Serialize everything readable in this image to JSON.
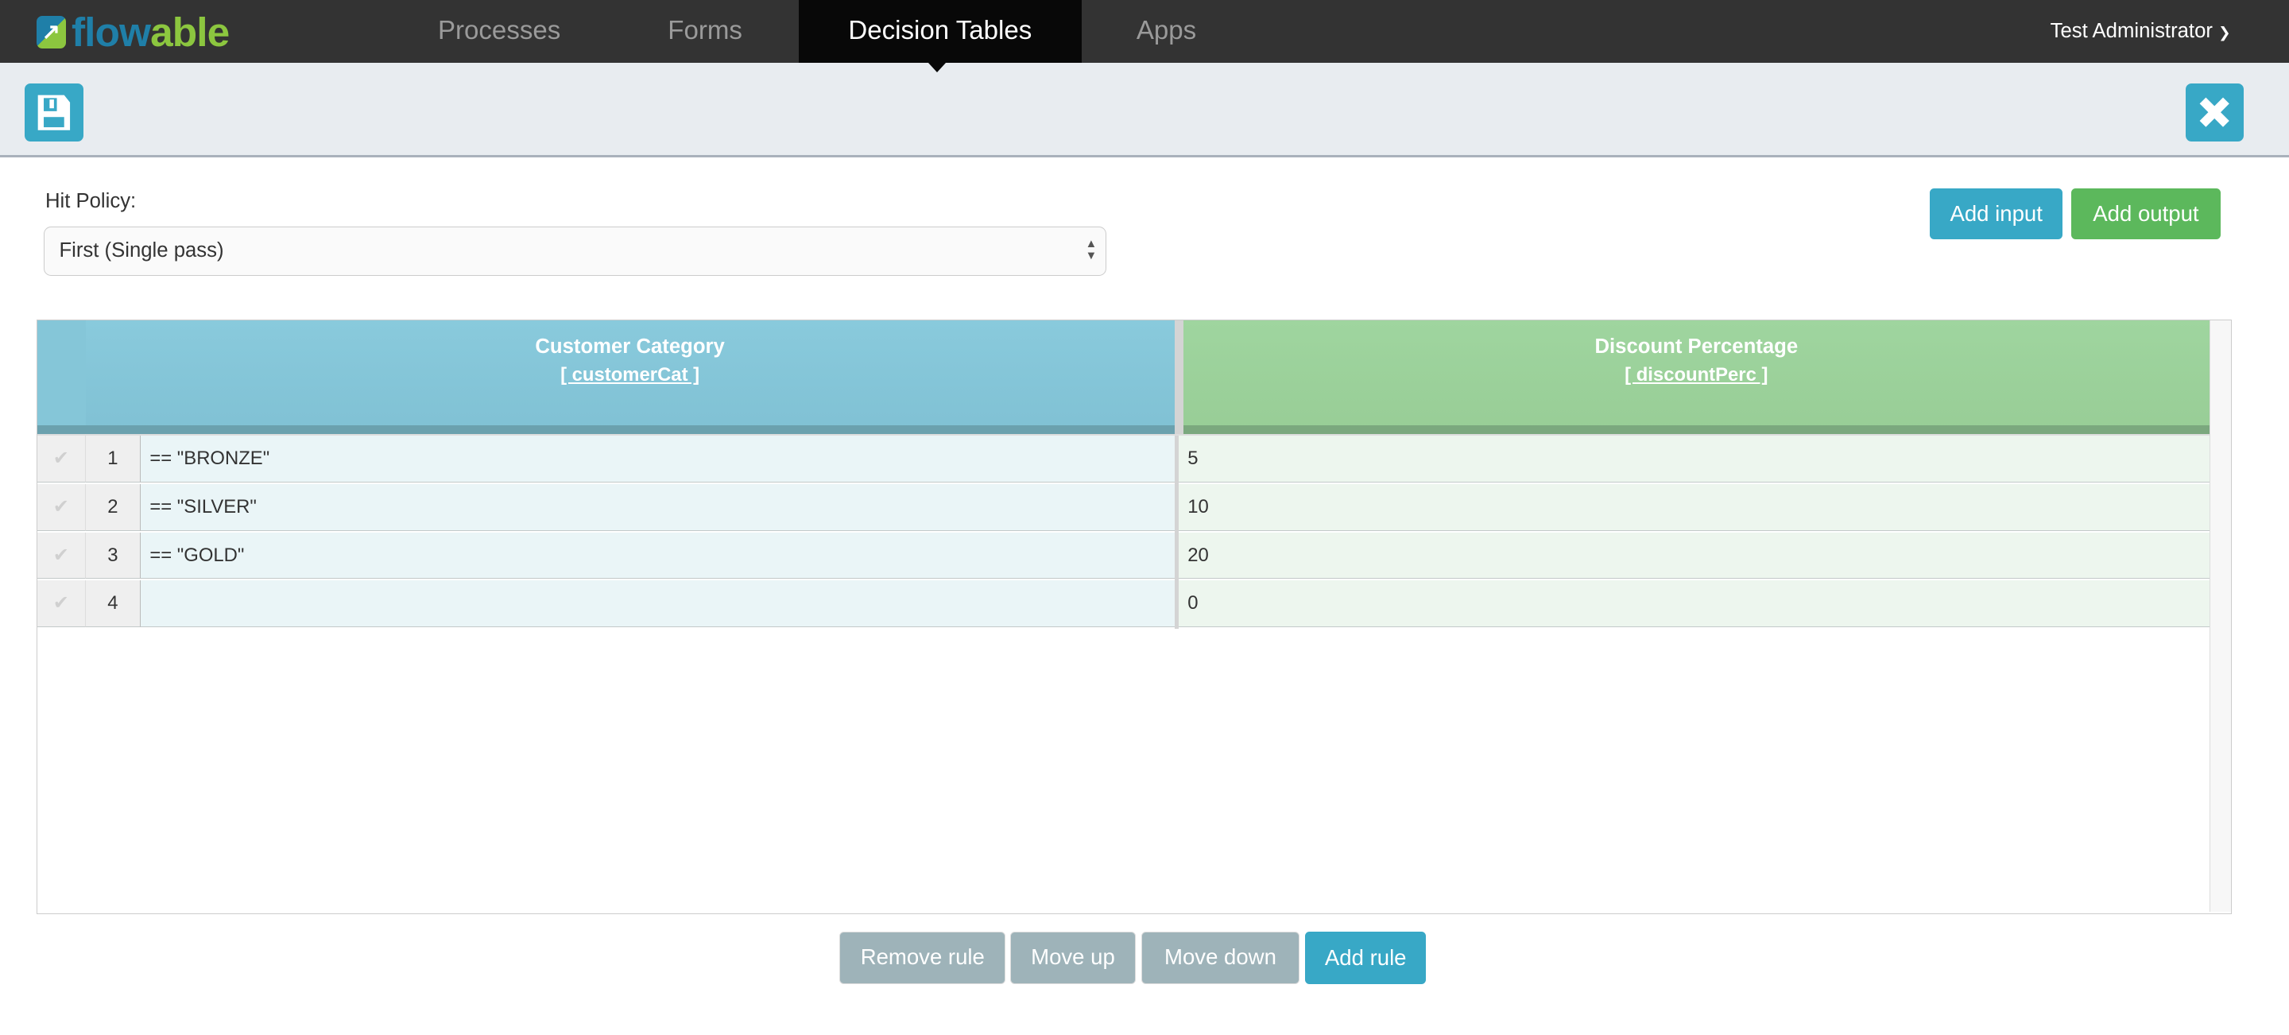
{
  "nav": {
    "logo": "flowable",
    "items": [
      {
        "label": "Processes"
      },
      {
        "label": "Forms"
      },
      {
        "label": "Decision Tables",
        "active": true
      },
      {
        "label": "Apps"
      }
    ],
    "user": "Test Administrator"
  },
  "toolbar": {
    "save_icon": "floppy-disk-icon",
    "close_icon": "close-x-icon"
  },
  "hit_policy": {
    "label": "Hit Policy:",
    "value": "First (Single pass)"
  },
  "actions": {
    "add_input": "Add input",
    "add_output": "Add output"
  },
  "table": {
    "input": {
      "title": "Customer Category",
      "variable": "[ customerCat ]"
    },
    "output": {
      "title": "Discount Percentage",
      "variable": "[ discountPerc ]"
    },
    "rows": [
      {
        "num": "1",
        "input": "== \"BRONZE\"",
        "output": "5"
      },
      {
        "num": "2",
        "input": "== \"SILVER\"",
        "output": "10"
      },
      {
        "num": "3",
        "input": "== \"GOLD\"",
        "output": "20"
      },
      {
        "num": "4",
        "input": "",
        "output": "0"
      }
    ]
  },
  "footer": {
    "remove": "Remove rule",
    "up": "Move up",
    "down": "Move down",
    "add": "Add rule"
  },
  "colors": {
    "primary": "#38a8c6",
    "success": "#5cb85c",
    "input_header": "#88c9dc",
    "output_header": "#9fd49f"
  }
}
